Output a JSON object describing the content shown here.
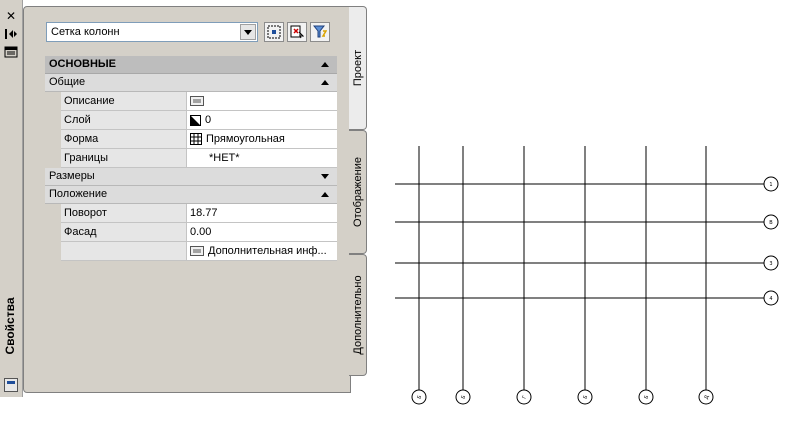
{
  "palette": {
    "panel_bg": "#d4d0c8",
    "section_bg": "#bdbdbd",
    "group_bg": "#dcdcdc",
    "value_bg": "#ffffff",
    "line": "#000000"
  },
  "strip": {
    "title": "Свойства",
    "icons": [
      "close-icon",
      "auto-hide-icon",
      "properties-menu-icon",
      "properties-small-icon"
    ]
  },
  "toolbar": {
    "selection": "Сетка колонн",
    "buttons": [
      "toggle-pickadd-icon",
      "select-objects-icon",
      "quick-select-icon"
    ]
  },
  "tabs": [
    "Проект",
    "Отображение",
    "Дополнительно"
  ],
  "sections": {
    "main": "ОСНОВНЫЕ",
    "general": "Общие",
    "dimensions": "Размеры",
    "location": "Положение"
  },
  "properties": {
    "description": {
      "label": "Описание",
      "value": ""
    },
    "layer": {
      "label": "Слой",
      "value": "0"
    },
    "shape": {
      "label": "Форма",
      "value": "Прямоугольная"
    },
    "boundary": {
      "label": "Границы",
      "value": "*НЕТ*"
    },
    "rotation": {
      "label": "Поворот",
      "value": "18.77"
    },
    "elevation": {
      "label": "Фасад",
      "value": "0.00"
    },
    "additional": {
      "label": "",
      "value": "Дополнительная инф..."
    }
  },
  "grid": {
    "row_labels": [
      "1",
      "В",
      "3",
      "4"
    ],
    "column_labels": [
      "Б",
      "Б",
      "Г",
      "Б",
      "Б",
      "Д"
    ]
  }
}
